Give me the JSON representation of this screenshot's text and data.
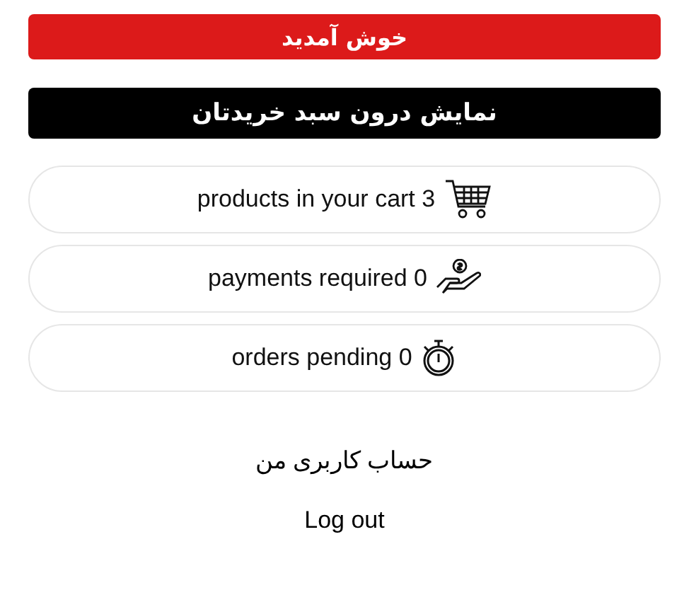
{
  "welcome_banner": {
    "text": "خوش آمدید"
  },
  "cart_button": {
    "label": "نمایش درون سبد خریدتان"
  },
  "stats": [
    {
      "kind": "cart",
      "text": "products in your cart 3"
    },
    {
      "kind": "payment",
      "text": "payments required 0"
    },
    {
      "kind": "timer",
      "text": "orders pending 0"
    }
  ],
  "links": [
    "حساب کاربری من",
    "Log out"
  ]
}
